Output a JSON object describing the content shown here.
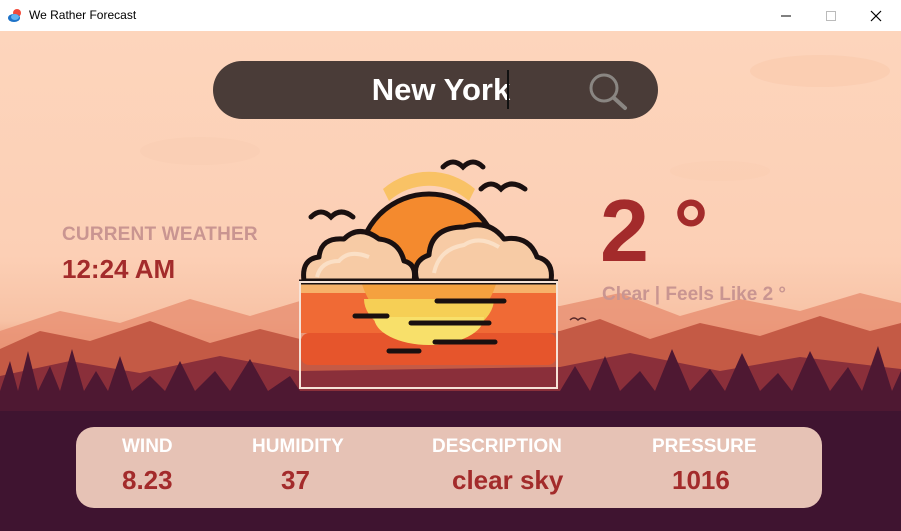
{
  "window": {
    "title": "We Rather Forecast",
    "app_icon": "weather-cloud-icon",
    "controls": [
      "minimize-icon",
      "maximize-icon",
      "close-icon"
    ]
  },
  "search": {
    "value": "New York",
    "icon": "search-icon"
  },
  "current_weather": {
    "label": "CURRENT WEATHER",
    "time": "12:24 AM"
  },
  "illustration": {
    "icon": "sunset-clouds-icon"
  },
  "temperature": {
    "value": "2 °",
    "description": "Clear | Feels Like 2 °"
  },
  "details": {
    "wind": {
      "label": "WIND",
      "value": "8.23"
    },
    "humidity": {
      "label": "HUMIDITY",
      "value": "37"
    },
    "description": {
      "label": "DESCRIPTION",
      "value": "clear sky"
    },
    "pressure": {
      "label": "PRESSURE",
      "value": "1016"
    }
  },
  "colors": {
    "accent_red": "#a32b2b",
    "muted_label": "#c99591",
    "search_bg": "#4a3c38",
    "panel_bg": "#e6c2b5",
    "sky_peach": "#fdd5bc"
  }
}
